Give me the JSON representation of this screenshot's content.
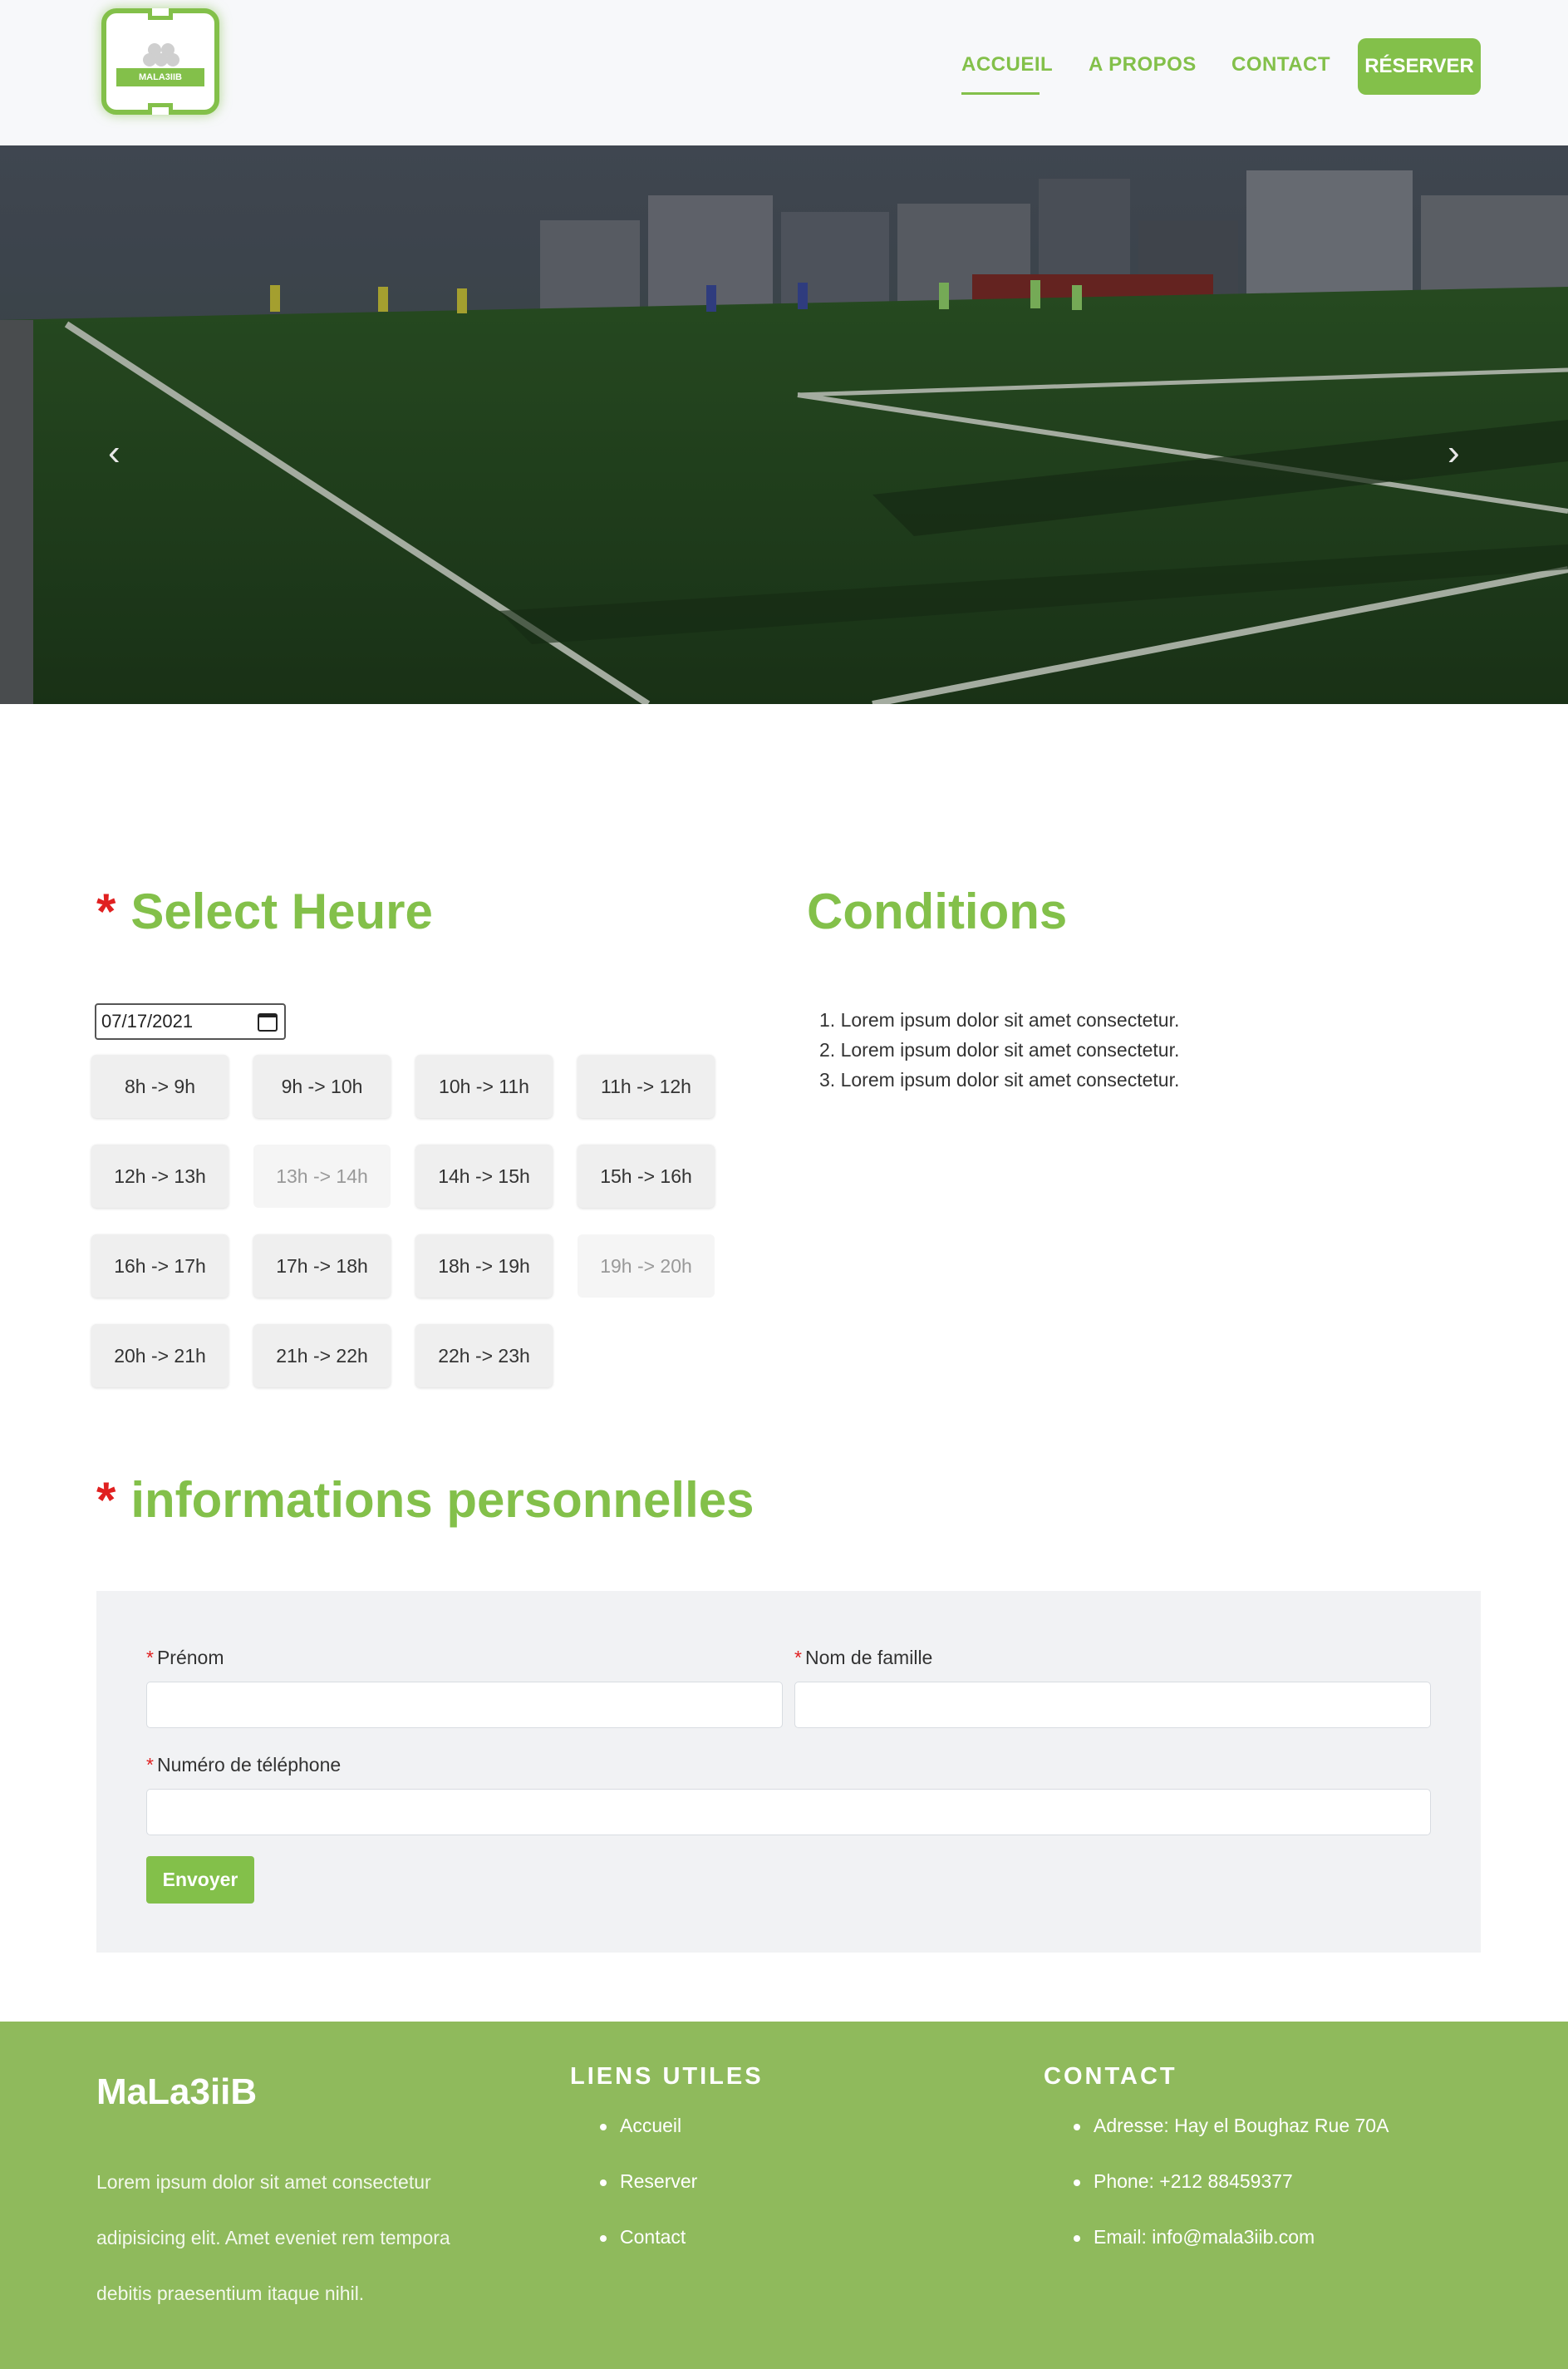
{
  "brand": {
    "logo_text": "MALA3IIB",
    "name": "MaLa3iiB"
  },
  "nav": {
    "items": [
      {
        "label": "ACCUEIL",
        "active": true
      },
      {
        "label": "A PROPOS",
        "active": false
      },
      {
        "label": "CONTACT",
        "active": false
      }
    ],
    "cta_label": "RÉSERVER"
  },
  "colors": {
    "accent": "#83c04a",
    "required": "#e02020",
    "footer_bg": "#8fba5c"
  },
  "hero": {
    "prev_icon": "chevron-left-icon",
    "next_icon": "chevron-right-icon"
  },
  "select_heure": {
    "star": "*",
    "title": "Select Heure",
    "date_value": "07/17/2021",
    "slots": [
      {
        "label": "8h -> 9h",
        "disabled": false
      },
      {
        "label": "9h -> 10h",
        "disabled": false
      },
      {
        "label": "10h -> 11h",
        "disabled": false
      },
      {
        "label": "11h -> 12h",
        "disabled": false
      },
      {
        "label": "12h -> 13h",
        "disabled": false
      },
      {
        "label": "13h -> 14h",
        "disabled": true
      },
      {
        "label": "14h -> 15h",
        "disabled": false
      },
      {
        "label": "15h -> 16h",
        "disabled": false
      },
      {
        "label": "16h -> 17h",
        "disabled": false
      },
      {
        "label": "17h -> 18h",
        "disabled": false
      },
      {
        "label": "18h -> 19h",
        "disabled": false
      },
      {
        "label": "19h -> 20h",
        "disabled": true
      },
      {
        "label": "20h -> 21h",
        "disabled": false
      },
      {
        "label": "21h -> 22h",
        "disabled": false
      },
      {
        "label": "22h -> 23h",
        "disabled": false
      }
    ]
  },
  "conditions": {
    "title": "Conditions",
    "items": [
      "1. Lorem ipsum dolor sit amet consectetur.",
      "2. Lorem ipsum dolor sit amet consectetur.",
      "3. Lorem ipsum dolor sit amet consectetur."
    ]
  },
  "personal": {
    "star": "*",
    "title": "informations personnelles",
    "required_mark": "*",
    "prenom_label": "Prénom",
    "nom_label": "Nom de famille",
    "phone_label": "Numéro de téléphone",
    "prenom_value": "",
    "nom_value": "",
    "phone_value": "",
    "submit_label": "Envoyer"
  },
  "footer": {
    "brand": "MaLa3iiB",
    "text_lines": [
      "Lorem ipsum dolor sit amet consectetur",
      "adipisicing elit. Amet eveniet rem tempora",
      "debitis praesentium itaque nihil."
    ],
    "links_heading": "LIENS UTILES",
    "links": [
      "Accueil",
      "Reserver",
      "Contact"
    ],
    "contact_heading": "CONTACT",
    "contact": [
      "Adresse: Hay el Boughaz Rue 70A",
      "Phone: +212 88459377",
      "Email: info@mala3iib.com"
    ]
  }
}
